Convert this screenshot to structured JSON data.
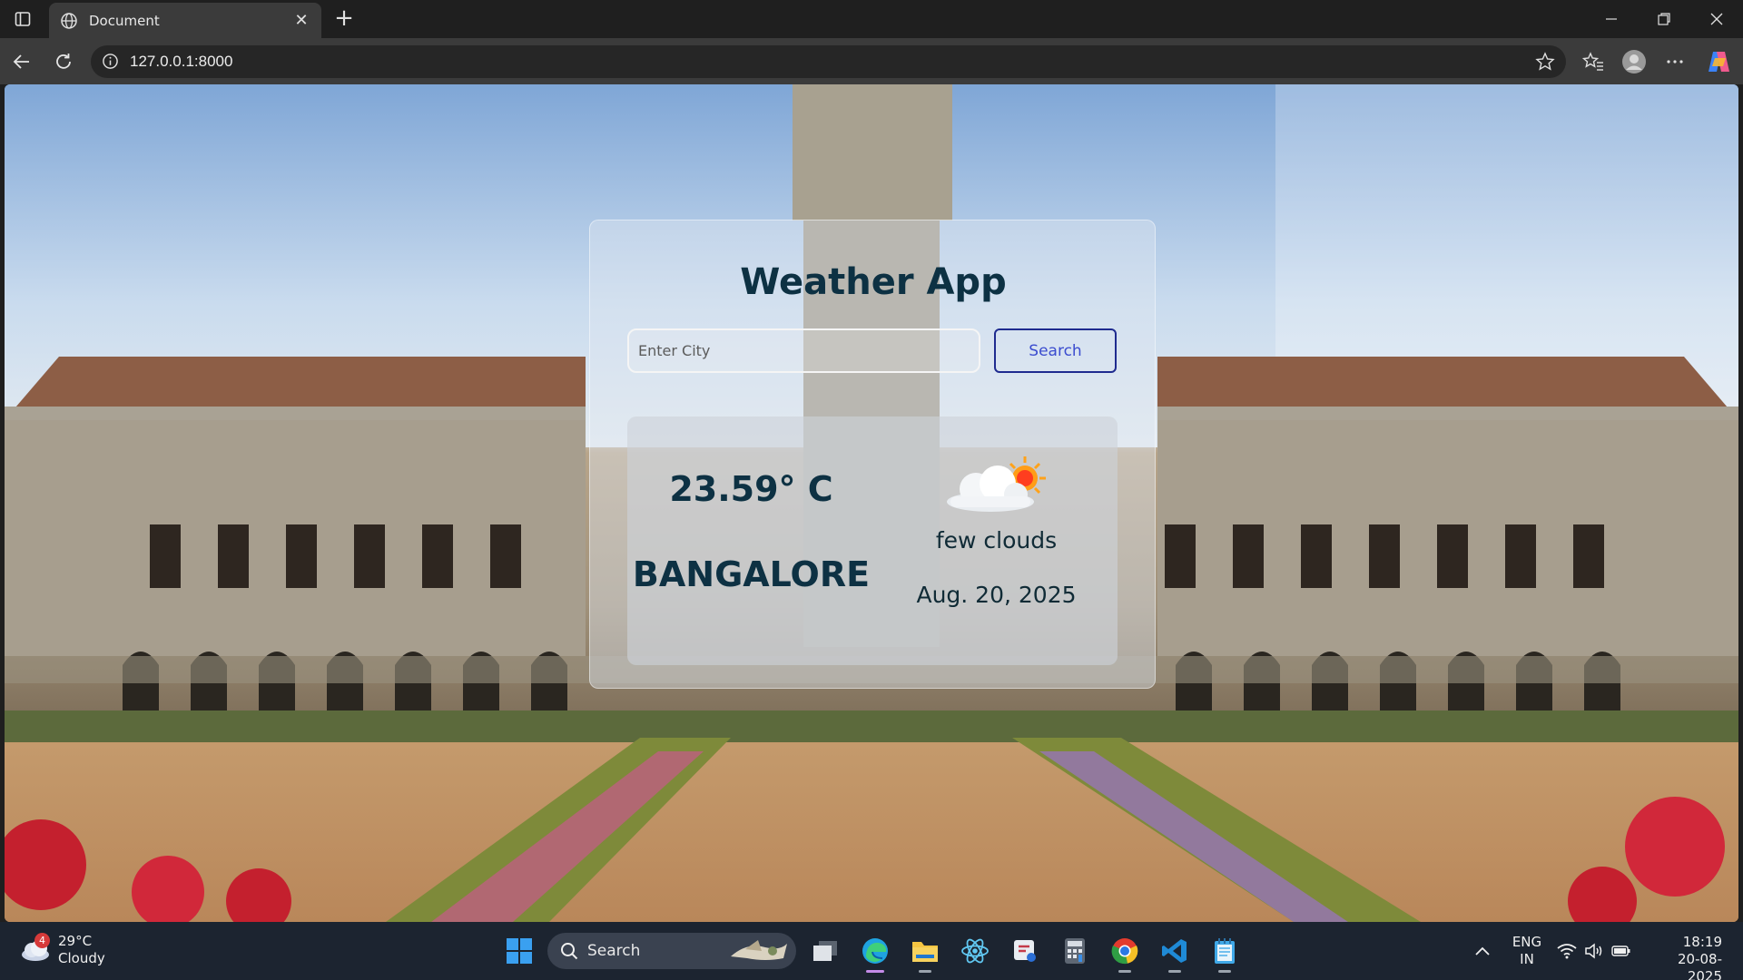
{
  "browser": {
    "tab_title": "Document",
    "url": "127.0.0.1:8000"
  },
  "app": {
    "title": "Weather App",
    "search": {
      "placeholder": "Enter City",
      "value": "",
      "button_label": "Search"
    },
    "result": {
      "temperature": "23.59° C",
      "city": "BANGALORE",
      "description": "few clouds",
      "date": "Aug. 20, 2025",
      "icon": "few-clouds-icon"
    }
  },
  "taskbar": {
    "weather": {
      "badge": "4",
      "temp": "29°C",
      "condition": "Cloudy"
    },
    "search_label": "Search",
    "language": {
      "line1": "ENG",
      "line2": "IN"
    },
    "clock": {
      "time": "18:19",
      "date": "20-08-2025"
    }
  },
  "colors": {
    "title_text": "#0d3143",
    "search_button_border": "#1f2b8f",
    "taskbar_bg": "#1c2430"
  }
}
